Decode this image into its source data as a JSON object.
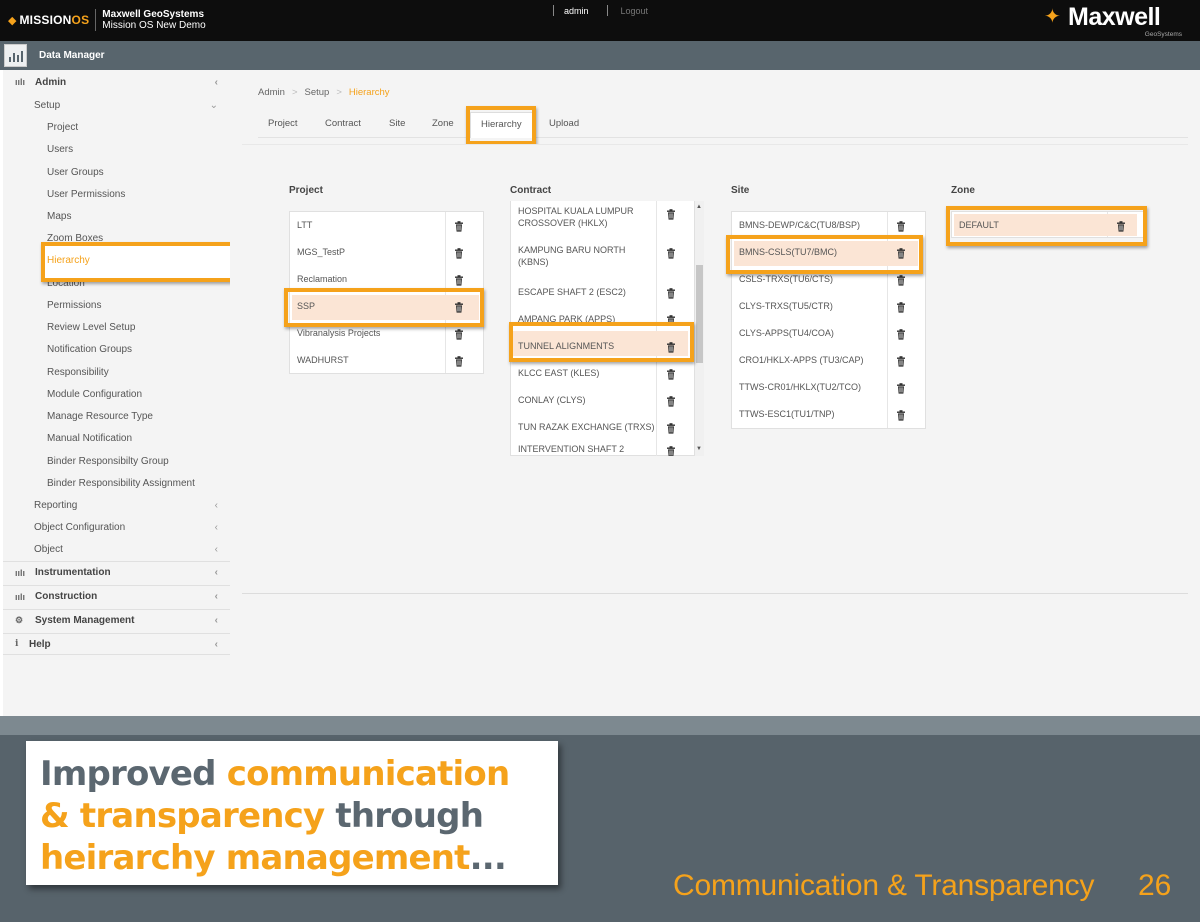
{
  "header": {
    "brand": {
      "mission": "MISSION",
      "os": "OS"
    },
    "org_name": "Maxwell GeoSystems",
    "org_sub": "Mission OS New Demo",
    "user": "admin",
    "logout": "Logout",
    "logo_word": "Maxwell",
    "logo_sub": "GeoSystems"
  },
  "titlebar": {
    "title": "Data Manager"
  },
  "sidebar": {
    "admin": "Admin",
    "setup": "Setup",
    "setup_items": [
      "Project",
      "Users",
      "User Groups",
      "User Permissions",
      "Maps",
      "Zoom Boxes",
      "Hierarchy",
      "Location",
      "Permissions",
      "Review Level Setup",
      "Notification Groups",
      "Responsibility",
      "Module Configuration",
      "Manage Resource Type",
      "Manual Notification",
      "Binder Responsibilty Group",
      "Binder Responsibility Assignment"
    ],
    "admin_items": [
      "Reporting",
      "Object Configuration",
      "Object"
    ],
    "main_items": [
      "Instrumentation",
      "Construction",
      "System Management",
      "Help"
    ]
  },
  "breadcrumb": {
    "a": "Admin",
    "b": "Setup",
    "c": "Hierarchy"
  },
  "tabs": [
    "Project",
    "Contract",
    "Site",
    "Zone",
    "Hierarchy",
    "Upload"
  ],
  "columns": {
    "project": {
      "title": "Project",
      "items": [
        "LTT",
        "MGS_TestP",
        "Reclamation",
        "SSP",
        "Vibranalysis Projects",
        "WADHURST"
      ]
    },
    "contract": {
      "title": "Contract",
      "items": [
        {
          "l1": "HOSPITAL KUALA LUMPUR",
          "l2": "CROSSOVER (HKLX)"
        },
        {
          "l1": "KAMPUNG BARU NORTH",
          "l2": "(KBNS)"
        },
        {
          "l1": "ESCAPE SHAFT 2 (ESC2)",
          "l2": ""
        },
        {
          "l1": "AMPANG PARK (APPS)",
          "l2": ""
        },
        {
          "l1": "TUNNEL ALIGNMENTS",
          "l2": ""
        },
        {
          "l1": "KLCC EAST (KLES)",
          "l2": ""
        },
        {
          "l1": "CONLAY (CLYS)",
          "l2": ""
        },
        {
          "l1": "TUN RAZAK EXCHANGE (TRXS)",
          "l2": ""
        },
        {
          "l1": "INTERVENTION SHAFT 2",
          "l2": ""
        }
      ]
    },
    "site": {
      "title": "Site",
      "items": [
        "BMNS-DEWP/C&C(TU8/BSP)",
        "BMNS-CSLS(TU7/BMC)",
        "CSLS-TRXS(TU6/CTS)",
        "CLYS-TRXS(TU5/CTR)",
        "CLYS-APPS(TU4/COA)",
        "CRO1/HKLX-APPS (TU3/CAP)",
        "TTWS-CR01/HKLX(TU2/TCO)",
        "TTWS-ESC1(TU1/TNP)"
      ]
    },
    "zone": {
      "title": "Zone",
      "items": [
        "DEFAULT"
      ]
    }
  },
  "footer": {
    "callout": {
      "w1": "Improved ",
      "w2": "communication",
      "w3": "& transparency",
      "w4": " through",
      "w5": "heirarchy management",
      "w6": "..."
    },
    "tagline": "Communication & Transparency",
    "page_number": "26"
  },
  "colors": {
    "accent": "#f5a21b",
    "slate": "#57636b",
    "highlight_fill": "#fbe5d5"
  }
}
